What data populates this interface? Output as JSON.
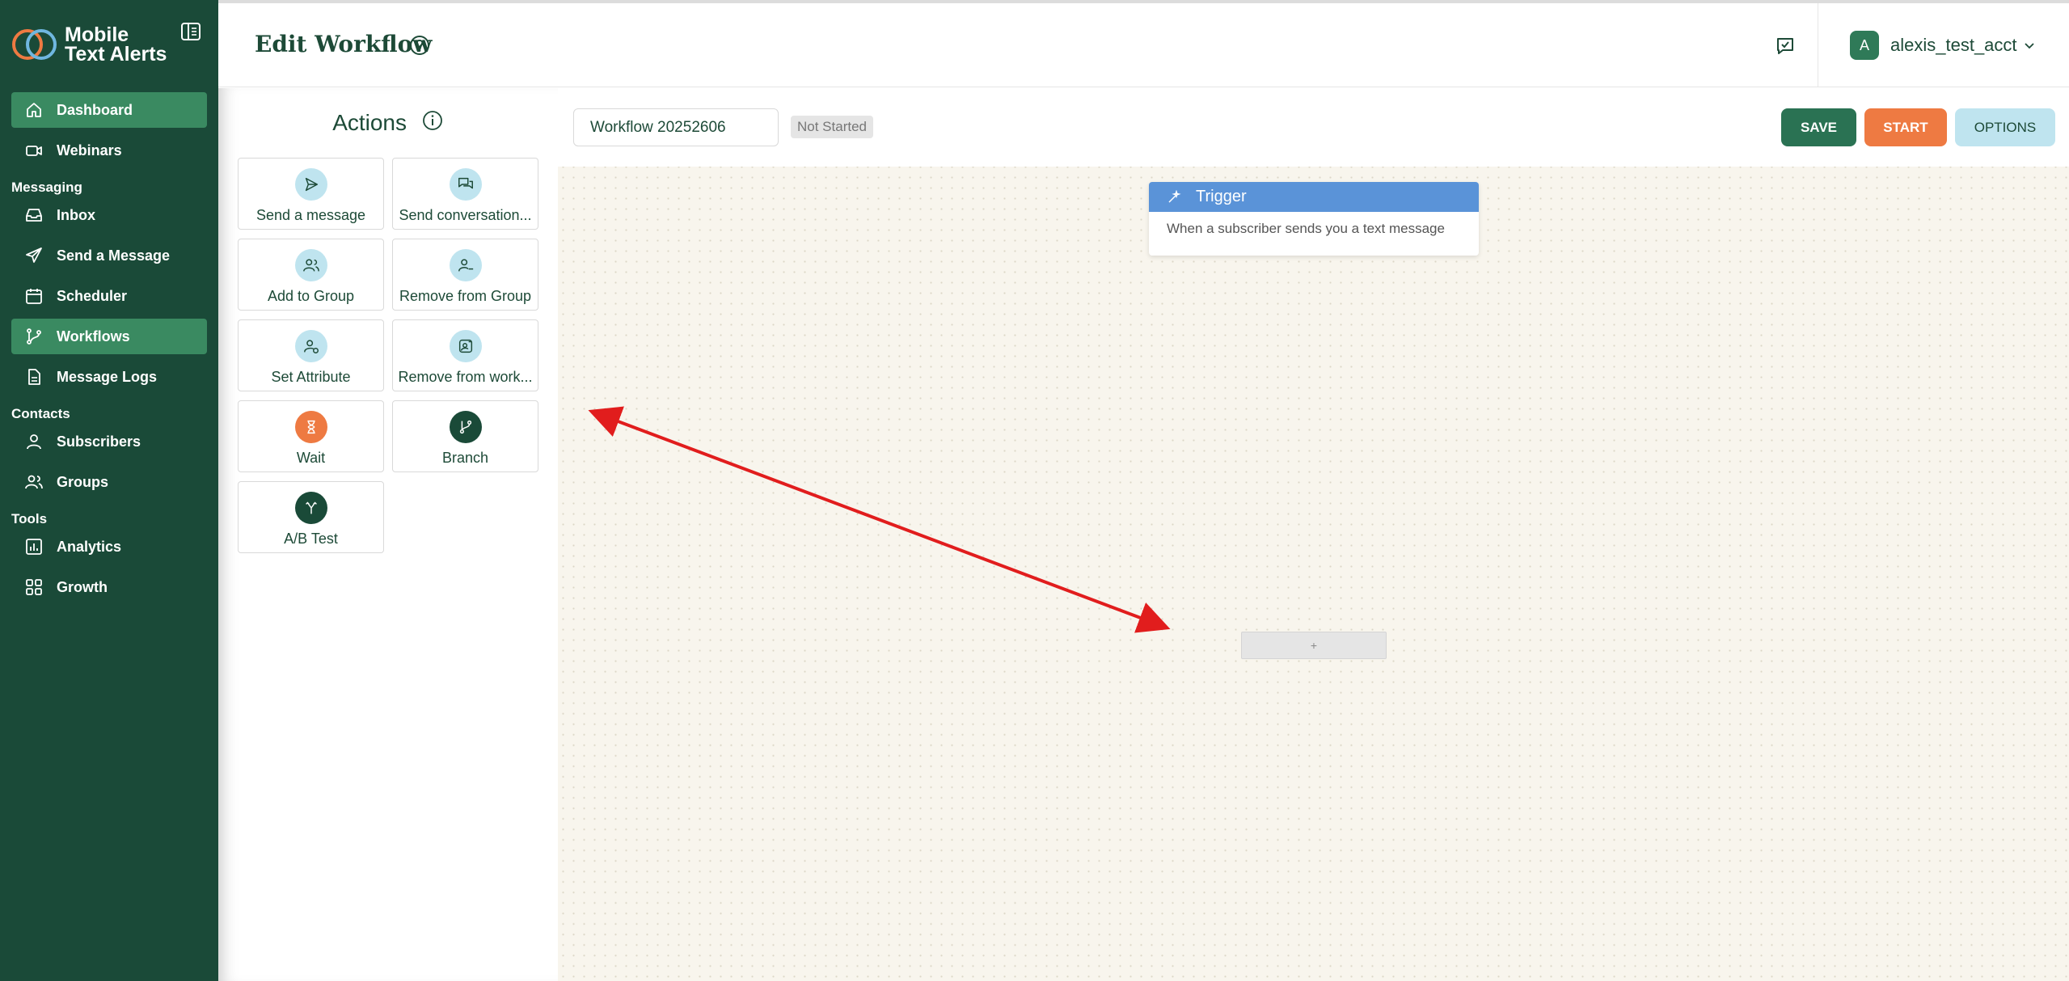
{
  "app": {
    "brand_line1": "Mobile",
    "brand_line2": "Text Alerts"
  },
  "sidebar": {
    "items": [
      {
        "label": "Dashboard",
        "icon": "home-icon",
        "active": true
      },
      {
        "label": "Webinars",
        "icon": "video-icon"
      },
      {
        "section": "Messaging"
      },
      {
        "label": "Inbox",
        "icon": "inbox-icon"
      },
      {
        "label": "Send a Message",
        "icon": "send-icon"
      },
      {
        "label": "Scheduler",
        "icon": "calendar-icon"
      },
      {
        "label": "Workflows",
        "icon": "workflow-icon",
        "active": true
      },
      {
        "label": "Message Logs",
        "icon": "document-icon"
      },
      {
        "section": "Contacts"
      },
      {
        "label": "Subscribers",
        "icon": "user-icon"
      },
      {
        "label": "Groups",
        "icon": "users-icon"
      },
      {
        "section": "Tools"
      },
      {
        "label": "Analytics",
        "icon": "chart-icon"
      },
      {
        "label": "Growth",
        "icon": "grid-icon"
      }
    ]
  },
  "header": {
    "title": "Edit Workflow",
    "account_initial": "A",
    "account_name": "alexis_test_acct"
  },
  "actions": {
    "title": "Actions",
    "cards": [
      {
        "label": "Send a message",
        "icon": "send-icon"
      },
      {
        "label": "Send conversation...",
        "icon": "chat-icon"
      },
      {
        "label": "Add to Group",
        "icon": "add-group-icon"
      },
      {
        "label": "Remove from Group",
        "icon": "remove-group-icon"
      },
      {
        "label": "Set Attribute",
        "icon": "attribute-icon"
      },
      {
        "label": "Remove from work...",
        "icon": "remove-workflow-icon"
      },
      {
        "label": "Wait",
        "icon": "hourglass-icon"
      },
      {
        "label": "Branch",
        "icon": "branch-icon"
      },
      {
        "label": "A/B Test",
        "icon": "ab-test-icon"
      }
    ]
  },
  "toolbar": {
    "workflow_name": "Workflow 20252606",
    "status": "Not Started",
    "save_label": "SAVE",
    "start_label": "START",
    "options_label": "OPTIONS"
  },
  "canvas": {
    "trigger_title": "Trigger",
    "trigger_text": "When a subscriber sends you a text message",
    "add_step_label": "+"
  },
  "colors": {
    "sidebar_bg": "#1a4a38",
    "sidebar_active": "#3a8a61",
    "save": "#2a7253",
    "start": "#ee7a42",
    "options": "#bfe4ef",
    "trigger_head": "#5a93d8",
    "annotation_arrow": "#e11d1d"
  }
}
